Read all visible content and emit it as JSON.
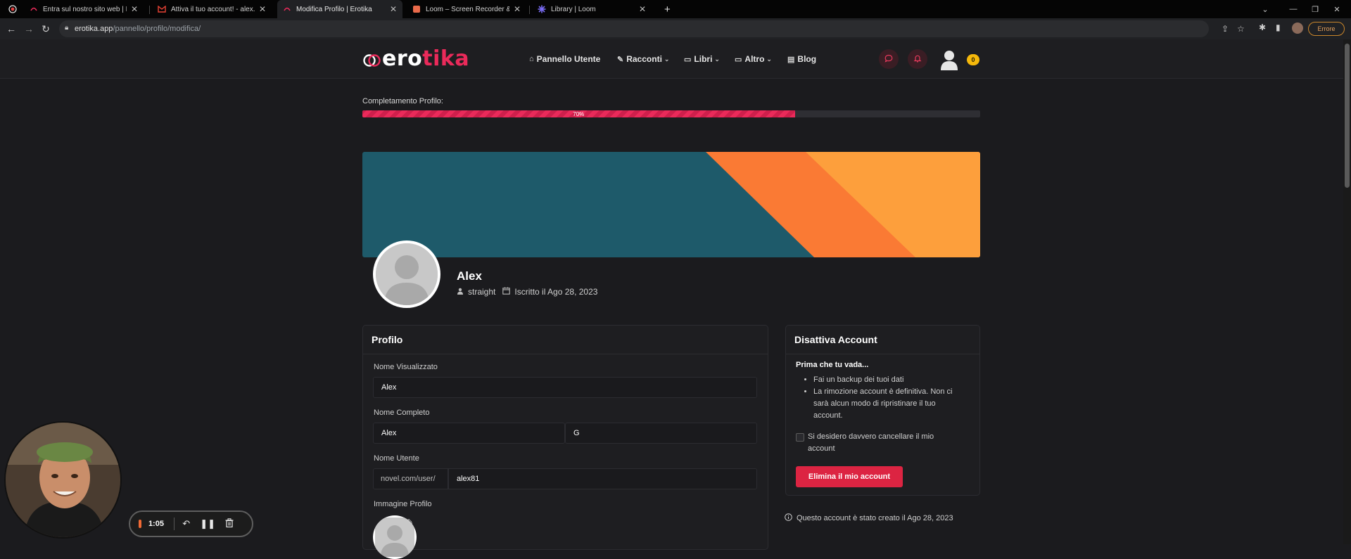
{
  "browser": {
    "tabs": [
      {
        "title": "Entra sul nostro sito web | Erotika",
        "active": false
      },
      {
        "title": "Attiva il tuo account! - alex.gamer",
        "active": false
      },
      {
        "title": "Modifica Profilo | Erotika",
        "active": true
      },
      {
        "title": "Loom – Screen Recorder & Screen",
        "active": false
      },
      {
        "title": "Library | Loom",
        "active": false
      }
    ],
    "new_tab_label": "+",
    "url_host": "erotika.app",
    "url_path": "/pannello/profilo/modifica/",
    "error_label": "Errore"
  },
  "header": {
    "logo_part1": "ero",
    "logo_part2": "tika",
    "nav": {
      "dashboard": "Pannello Utente",
      "stories": "Racconti",
      "books": "Libri",
      "more": "Altro",
      "blog": "Blog"
    },
    "notification_count": "0"
  },
  "progress": {
    "label": "Completamento Profilo:",
    "value_pct": 70,
    "value_label": "70%"
  },
  "profile": {
    "name": "Alex",
    "orientation": "straight",
    "joined": "Iscritto il Ago 28, 2023"
  },
  "profile_card": {
    "title": "Profilo",
    "display_name_label": "Nome Visualizzato",
    "display_name_value": "Alex",
    "full_name_label": "Nome Completo",
    "first_name_value": "Alex",
    "last_name_value": "G",
    "username_label": "Nome Utente",
    "username_prefix": "novel.com/user/",
    "username_value": "alex81",
    "image_label": "Immagine Profilo"
  },
  "deactivate_card": {
    "title": "Disattiva Account",
    "warning_title": "Prima che tu vada...",
    "bullets": [
      "Fai un backup dei tuoi dati",
      "La rimozione account è definitiva. Non ci sarà alcun modo di ripristinare il tuo account."
    ],
    "confirm_label": "Si desidero davvero cancellare il mio account",
    "delete_button": "Elimina il mio account",
    "created_note": "Questo account è stato creato il Ago 28, 2023"
  },
  "loom": {
    "time": "1:05"
  },
  "colors": {
    "brand": "#ea2a5a",
    "danger": "#dc2442",
    "badge": "#f5b80b",
    "banner_teal": "#1e5a6a",
    "banner_orange": "#fa7a34",
    "banner_yellow": "#fd9f3c"
  }
}
